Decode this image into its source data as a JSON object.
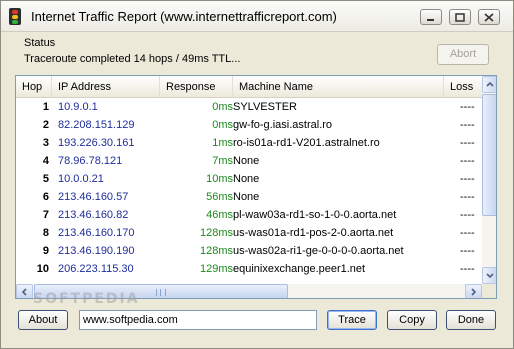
{
  "window": {
    "title": "Internet Traffic Report (www.internettrafficreport.com)",
    "icon": "traffic-light-icon",
    "controls": [
      "minimize-icon",
      "maximize-icon",
      "close-icon"
    ]
  },
  "status": {
    "legend": "Status",
    "text": "Traceroute completed 14 hops / 49ms TTL...",
    "abort_label": "Abort",
    "abort_enabled": false
  },
  "table": {
    "columns": [
      "Hop",
      "IP Address",
      "Response",
      "Machine Name",
      "Loss"
    ],
    "rows": [
      {
        "hop": "1",
        "ip": "10.9.0.1",
        "response": "0ms",
        "host": "SYLVESTER",
        "loss": "----"
      },
      {
        "hop": "2",
        "ip": "82.208.151.129",
        "response": "0ms",
        "host": "gw-fo-g.iasi.astral.ro",
        "loss": "----"
      },
      {
        "hop": "3",
        "ip": "193.226.30.161",
        "response": "1ms",
        "host": "ro-is01a-rd1-V201.astralnet.ro",
        "loss": "----"
      },
      {
        "hop": "4",
        "ip": "78.96.78.121",
        "response": "7ms",
        "host": "None",
        "loss": "----"
      },
      {
        "hop": "5",
        "ip": "10.0.0.21",
        "response": "10ms",
        "host": "None",
        "loss": "----"
      },
      {
        "hop": "6",
        "ip": "213.46.160.57",
        "response": "56ms",
        "host": "None",
        "loss": "----"
      },
      {
        "hop": "7",
        "ip": "213.46.160.82",
        "response": "46ms",
        "host": "pl-waw03a-rd1-so-1-0-0.aorta.net",
        "loss": "----"
      },
      {
        "hop": "8",
        "ip": "213.46.160.170",
        "response": "128ms",
        "host": "us-was01a-rd1-pos-2-0.aorta.net",
        "loss": "----"
      },
      {
        "hop": "9",
        "ip": "213.46.190.190",
        "response": "128ms",
        "host": "us-was02a-ri1-ge-0-0-0-0.aorta.net",
        "loss": "----"
      },
      {
        "hop": "10",
        "ip": "206.223.115.30",
        "response": "129ms",
        "host": "equinixexchange.peer1.net",
        "loss": "----"
      }
    ]
  },
  "watermark": "SOFTPEDIA",
  "footer": {
    "about_label": "About",
    "url_value": "www.softpedia.com",
    "trace_label": "Trace",
    "copy_label": "Copy",
    "done_label": "Done"
  },
  "colors": {
    "ip_text": "#1f2e9a",
    "response_text": "#1d8a1d",
    "window_bg": "#ece9d8"
  }
}
